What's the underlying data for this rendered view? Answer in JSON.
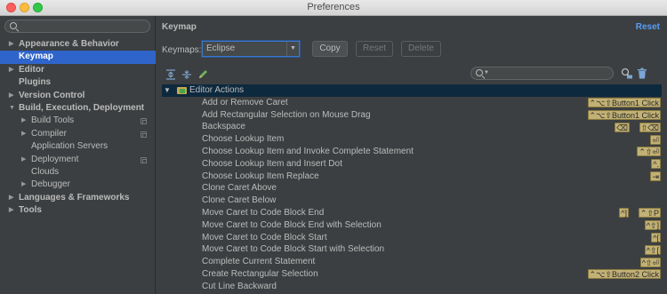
{
  "window": {
    "title": "Preferences"
  },
  "sidebar": {
    "search_placeholder": "",
    "items": [
      {
        "label": "Appearance & Behavior",
        "arrow": "▶",
        "level": 0,
        "bold": true,
        "selected": false,
        "project": false
      },
      {
        "label": "Keymap",
        "arrow": "",
        "level": 0,
        "bold": true,
        "selected": true,
        "project": false
      },
      {
        "label": "Editor",
        "arrow": "▶",
        "level": 0,
        "bold": true,
        "selected": false,
        "project": false
      },
      {
        "label": "Plugins",
        "arrow": "",
        "level": 0,
        "bold": true,
        "selected": false,
        "project": false
      },
      {
        "label": "Version Control",
        "arrow": "▶",
        "level": 0,
        "bold": true,
        "selected": false,
        "project": false
      },
      {
        "label": "Build, Execution, Deployment",
        "arrow": "▼",
        "level": 0,
        "bold": true,
        "selected": false,
        "project": false
      },
      {
        "label": "Build Tools",
        "arrow": "▶",
        "level": 1,
        "bold": false,
        "selected": false,
        "project": true
      },
      {
        "label": "Compiler",
        "arrow": "▶",
        "level": 1,
        "bold": false,
        "selected": false,
        "project": true
      },
      {
        "label": "Application Servers",
        "arrow": "",
        "level": 1,
        "bold": false,
        "selected": false,
        "project": false
      },
      {
        "label": "Deployment",
        "arrow": "▶",
        "level": 1,
        "bold": false,
        "selected": false,
        "project": true
      },
      {
        "label": "Clouds",
        "arrow": "",
        "level": 1,
        "bold": false,
        "selected": false,
        "project": false
      },
      {
        "label": "Debugger",
        "arrow": "▶",
        "level": 1,
        "bold": false,
        "selected": false,
        "project": false
      },
      {
        "label": "Languages & Frameworks",
        "arrow": "▶",
        "level": 0,
        "bold": true,
        "selected": false,
        "project": false
      },
      {
        "label": "Tools",
        "arrow": "▶",
        "level": 0,
        "bold": true,
        "selected": false,
        "project": false
      }
    ]
  },
  "main": {
    "title": "Keymap",
    "reset_label": "Reset",
    "keymaps_label": "Keymaps:",
    "keymap_value": "Eclipse",
    "copy_label": "Copy",
    "reset_button_label": "Reset",
    "delete_label": "Delete",
    "filter_placeholder": "",
    "group_label": "Editor Actions",
    "actions": [
      {
        "label": "Add or Remove Caret",
        "shortcuts": [
          "⌃⌥⇧Button1 Click"
        ]
      },
      {
        "label": "Add Rectangular Selection on Mouse Drag",
        "shortcuts": [
          "⌃⌥⇧Button1 Click"
        ]
      },
      {
        "label": "Backspace",
        "shortcuts": [
          "⌫",
          "⇧⌫"
        ]
      },
      {
        "label": "Choose Lookup Item",
        "shortcuts": [
          "⏎"
        ]
      },
      {
        "label": "Choose Lookup Item and Invoke Complete Statement",
        "shortcuts": [
          "⌃⇧⏎"
        ]
      },
      {
        "label": "Choose Lookup Item and Insert Dot",
        "shortcuts": [
          "^."
        ]
      },
      {
        "label": "Choose Lookup Item Replace",
        "shortcuts": [
          "⇥"
        ]
      },
      {
        "label": "Clone Caret Above",
        "shortcuts": []
      },
      {
        "label": "Clone Caret Below",
        "shortcuts": []
      },
      {
        "label": "Move Caret to Code Block End",
        "shortcuts": [
          "^]",
          "⌃⇧P"
        ]
      },
      {
        "label": "Move Caret to Code Block End with Selection",
        "shortcuts": [
          "^⇧]"
        ]
      },
      {
        "label": "Move Caret to Code Block Start",
        "shortcuts": [
          "^["
        ]
      },
      {
        "label": "Move Caret to Code Block Start with Selection",
        "shortcuts": [
          "^⇧["
        ]
      },
      {
        "label": "Complete Current Statement",
        "shortcuts": [
          "^⇧⏎"
        ]
      },
      {
        "label": "Create Rectangular Selection",
        "shortcuts": [
          "⌃⌥⇧Button2 Click"
        ]
      },
      {
        "label": "Cut Line Backward",
        "shortcuts": []
      }
    ]
  },
  "colors": {
    "background": "#3c3f41",
    "selection": "#2f65ca",
    "group_header": "#0d293e",
    "shortcut_badge": "#c2b175",
    "link": "#589df6"
  },
  "icons": {
    "toolbar": [
      "expand-all-icon",
      "collapse-all-icon",
      "edit-shortcut-icon"
    ],
    "find_by_shortcut": "find-by-shortcut-icon",
    "trash": "trash-icon"
  }
}
